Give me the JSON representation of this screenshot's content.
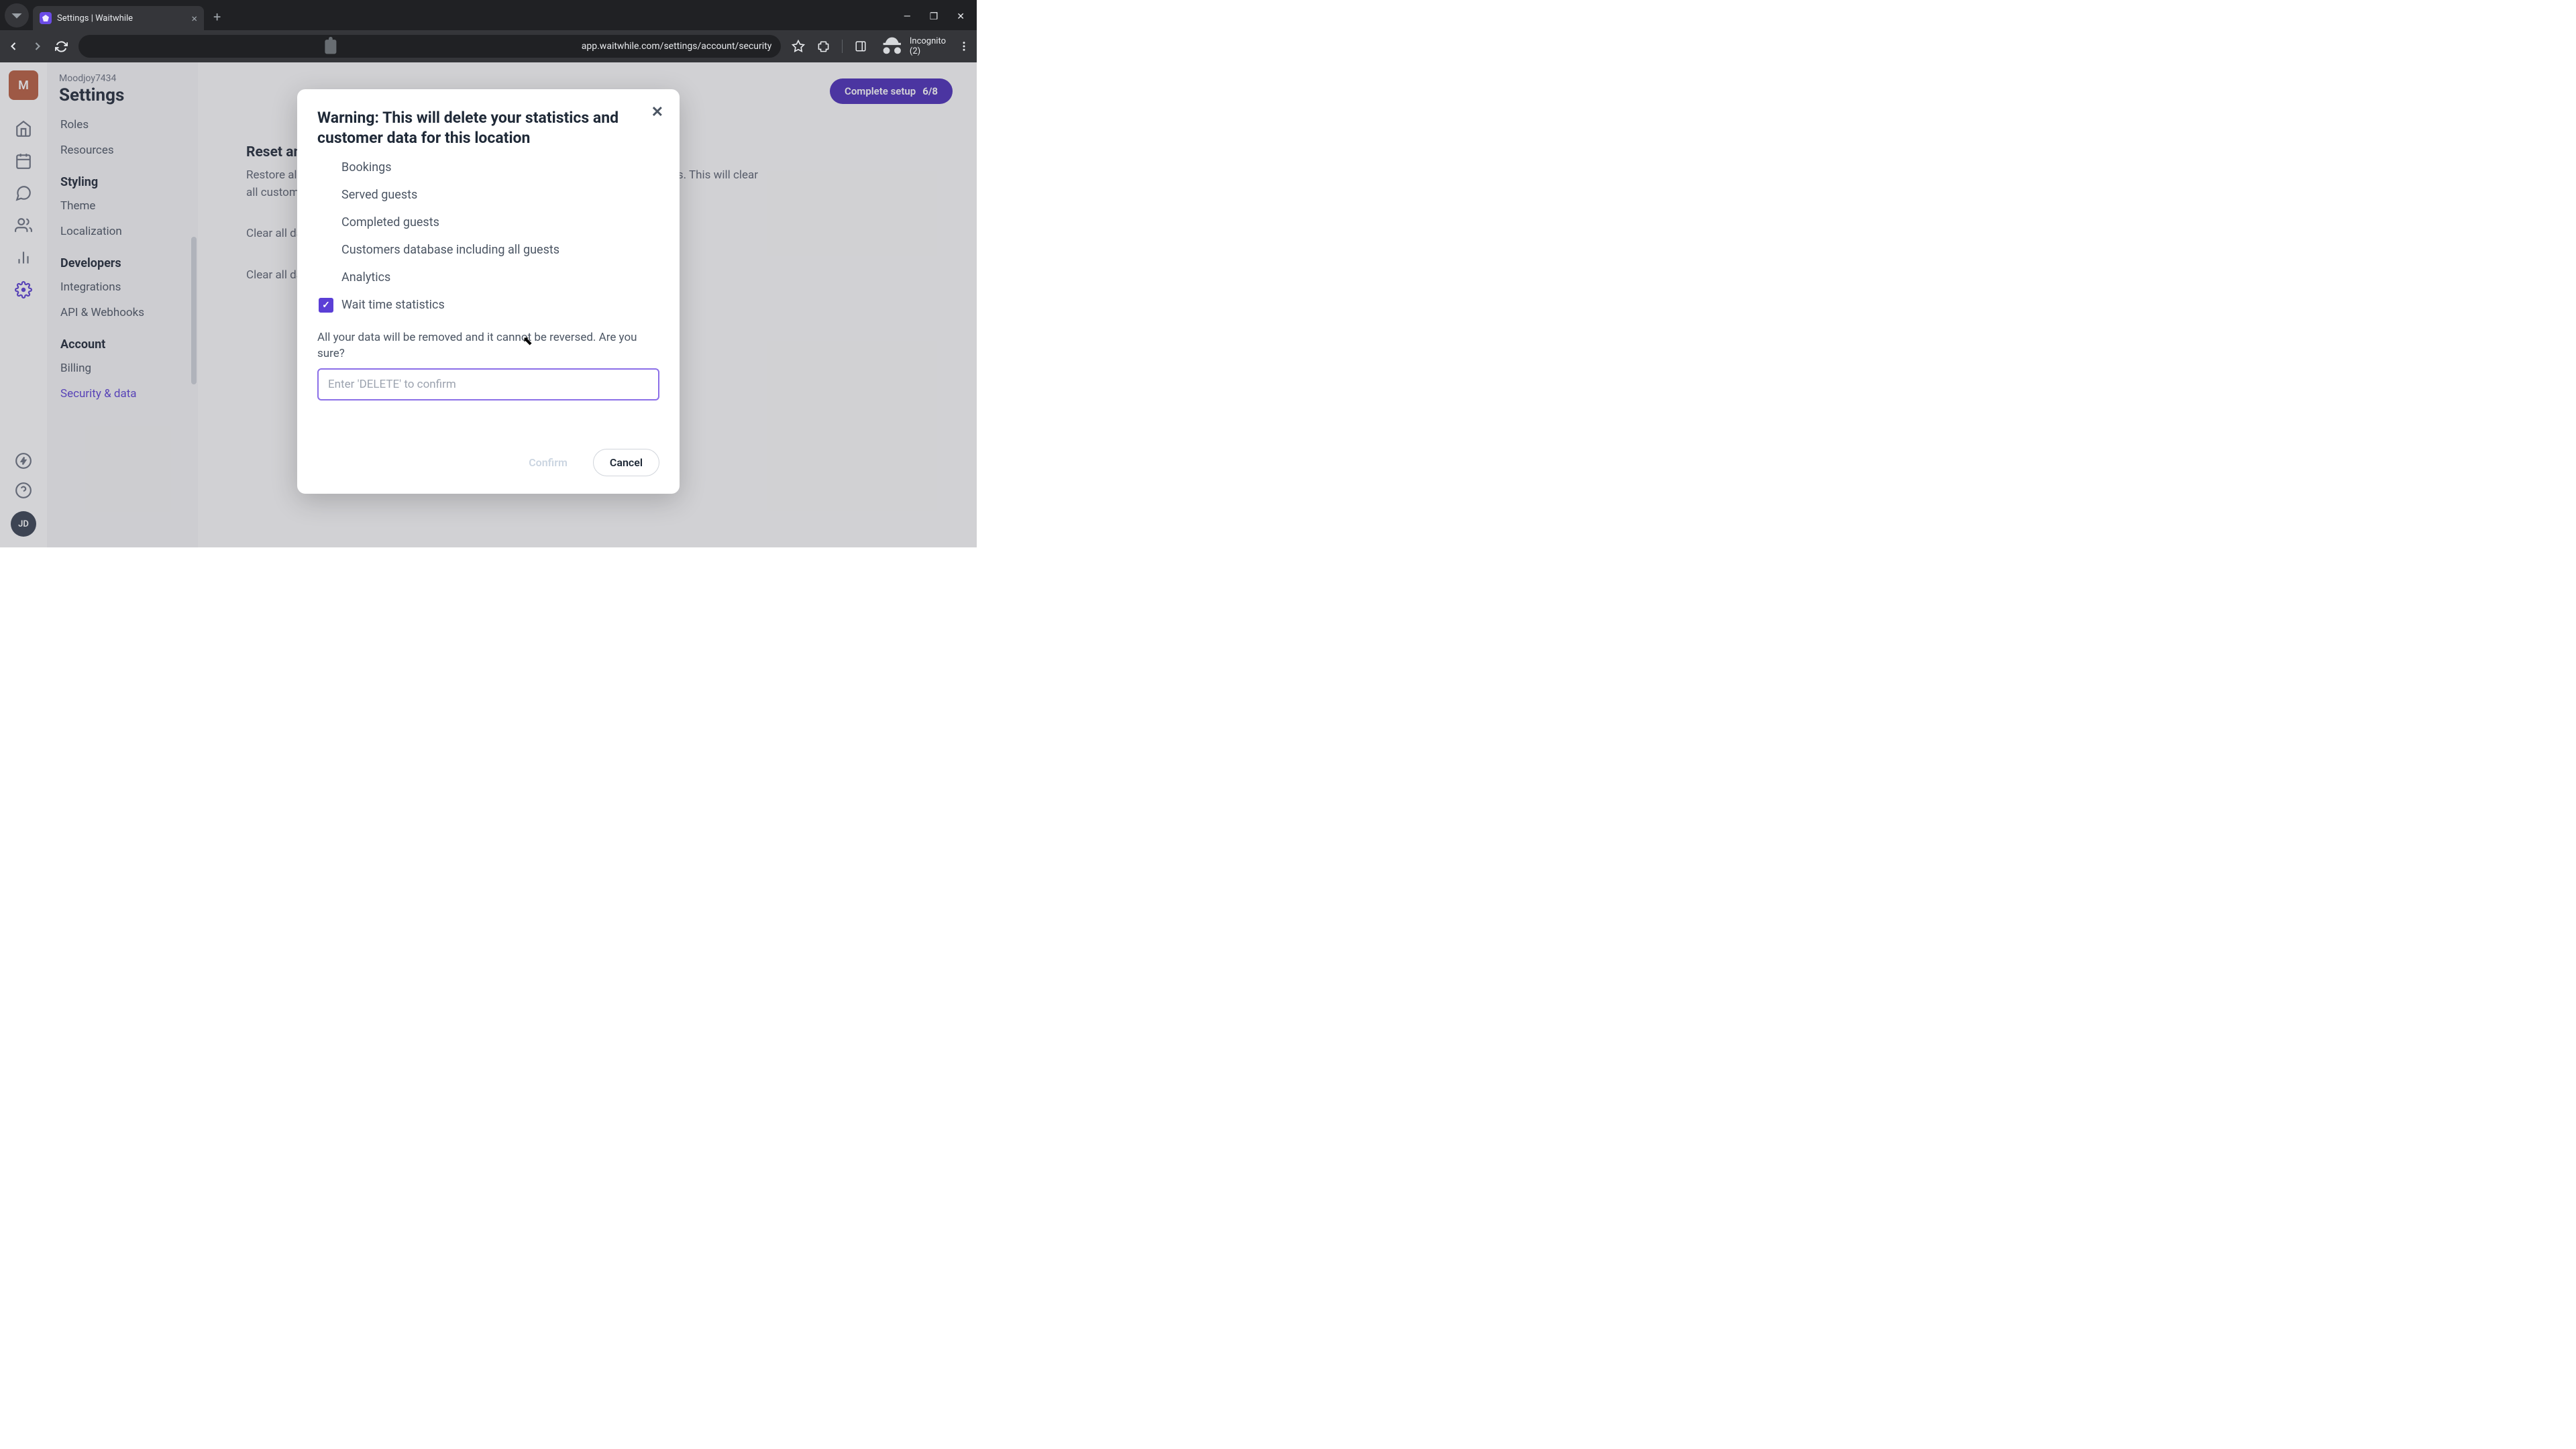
{
  "browser": {
    "tab_title": "Settings | Waitwhile",
    "url": "app.waitwhile.com/settings/account/security",
    "incognito_label": "Incognito (2)"
  },
  "rail": {
    "avatar_letter": "M",
    "user_initials": "JD"
  },
  "sidebar": {
    "workspace": "Moodjoy7434",
    "title": "Settings",
    "top_items": [
      "Roles",
      "Resources"
    ],
    "groups": [
      {
        "heading": "Styling",
        "items": [
          "Theme",
          "Localization"
        ]
      },
      {
        "heading": "Developers",
        "items": [
          "Integrations",
          "API & Webhooks"
        ]
      },
      {
        "heading": "Account",
        "items": [
          "Billing",
          "Security & data"
        ],
        "active_index": 1
      }
    ]
  },
  "header": {
    "setup_label": "Complete setup",
    "setup_count": "6/8"
  },
  "content": {
    "section_title": "Reset and clear data",
    "desc1": "Restore all settings to their original defaults and clear all data for waitlist and bookings. This will clear all customer data for waitlist and bookings and restore to the defaults.",
    "line2": "Clear all data including all customer data for waitlist and bookings.",
    "line3": "Clear all data including all customer data for waitlist and bookings."
  },
  "modal": {
    "title": "Warning: This will delete your statistics and customer data for this location",
    "items": [
      {
        "label": "Bookings",
        "checked": false
      },
      {
        "label": "Served guests",
        "checked": false
      },
      {
        "label": "Completed guests",
        "checked": false
      },
      {
        "label": "Customers database including all guests",
        "checked": false
      },
      {
        "label": "Analytics",
        "checked": false
      },
      {
        "label": "Wait time statistics",
        "checked": true
      }
    ],
    "warning": "All your data will be removed and it cannot be reversed. Are you sure?",
    "placeholder": "Enter 'DELETE' to confirm",
    "confirm": "Confirm",
    "cancel": "Cancel"
  }
}
